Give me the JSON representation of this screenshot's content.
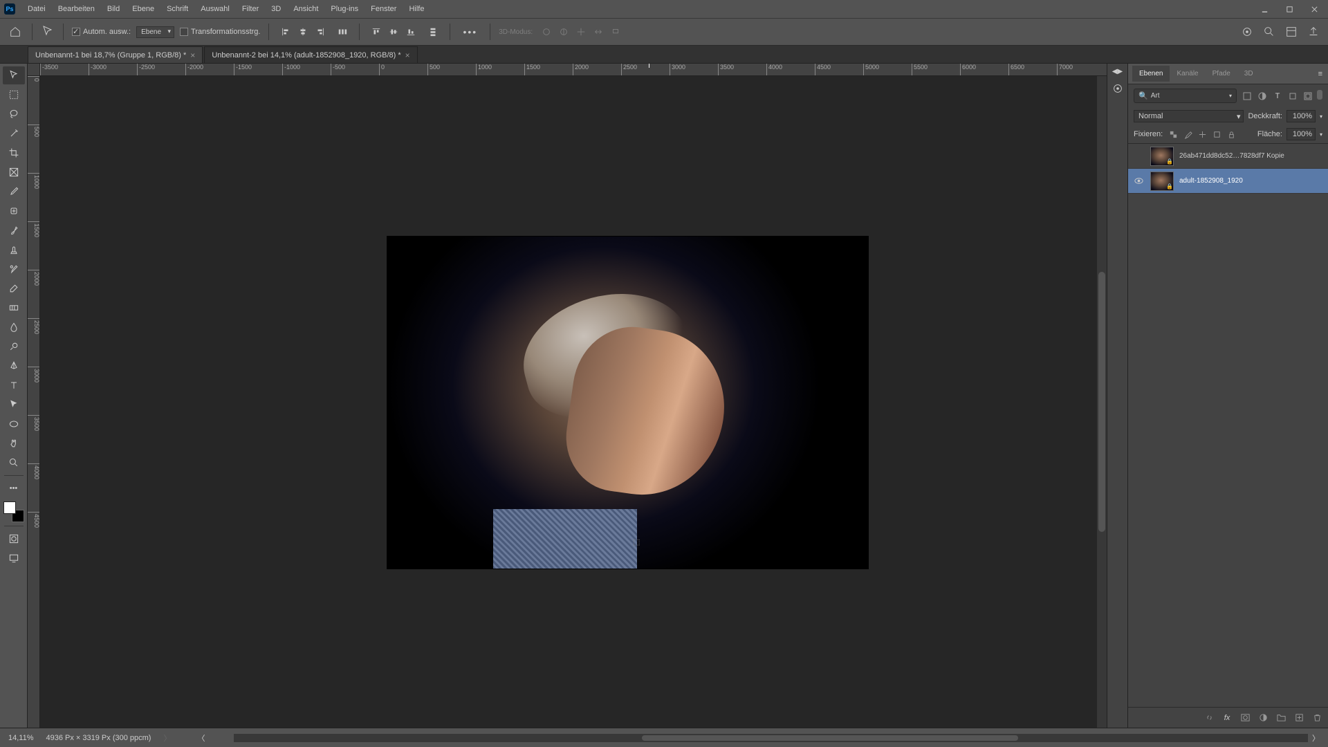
{
  "menu": {
    "items": [
      "Datei",
      "Bearbeiten",
      "Bild",
      "Ebene",
      "Schrift",
      "Auswahl",
      "Filter",
      "3D",
      "Ansicht",
      "Plug-ins",
      "Fenster",
      "Hilfe"
    ]
  },
  "options": {
    "auto_select_label": "Autom. ausw.:",
    "auto_select_target": "Ebene",
    "transform_label": "Transformationsstrg.",
    "mode_3d_label": "3D-Modus:"
  },
  "tabs": [
    {
      "label": "Unbenannt-1 bei 18,7% (Gruppe 1, RGB/8) *",
      "active": false
    },
    {
      "label": "Unbenannt-2 bei 14,1% (adult-1852908_1920, RGB/8) *",
      "active": true
    }
  ],
  "ruler_h": [
    "-3500",
    "-3000",
    "-2500",
    "-2000",
    "-1500",
    "-1000",
    "-500",
    "0",
    "500",
    "1000",
    "1500",
    "2000",
    "2500",
    "3000",
    "3500",
    "4000",
    "4500",
    "5000",
    "5500",
    "6000",
    "6500",
    "7000"
  ],
  "ruler_v": [
    "0",
    "500",
    "1000",
    "1500",
    "2000",
    "2500",
    "3000",
    "3500",
    "4000",
    "4500"
  ],
  "panels": {
    "tabs": [
      "Ebenen",
      "Kanäle",
      "Pfade",
      "3D"
    ],
    "search_placeholder": "Art",
    "blend_mode": "Normal",
    "opacity_label": "Deckkraft:",
    "opacity_value": "100%",
    "lock_label": "Fixieren:",
    "fill_label": "Fläche:",
    "fill_value": "100%"
  },
  "layers": [
    {
      "name": "26ab471dd8dc52…7828df7 Kopie",
      "visible": false,
      "selected": false,
      "locked": true
    },
    {
      "name": "adult-1852908_1920",
      "visible": true,
      "selected": true,
      "locked": true
    }
  ],
  "status": {
    "zoom": "14,11%",
    "doc_info": "4936 Px × 3319 Px (300 ppcm)"
  }
}
